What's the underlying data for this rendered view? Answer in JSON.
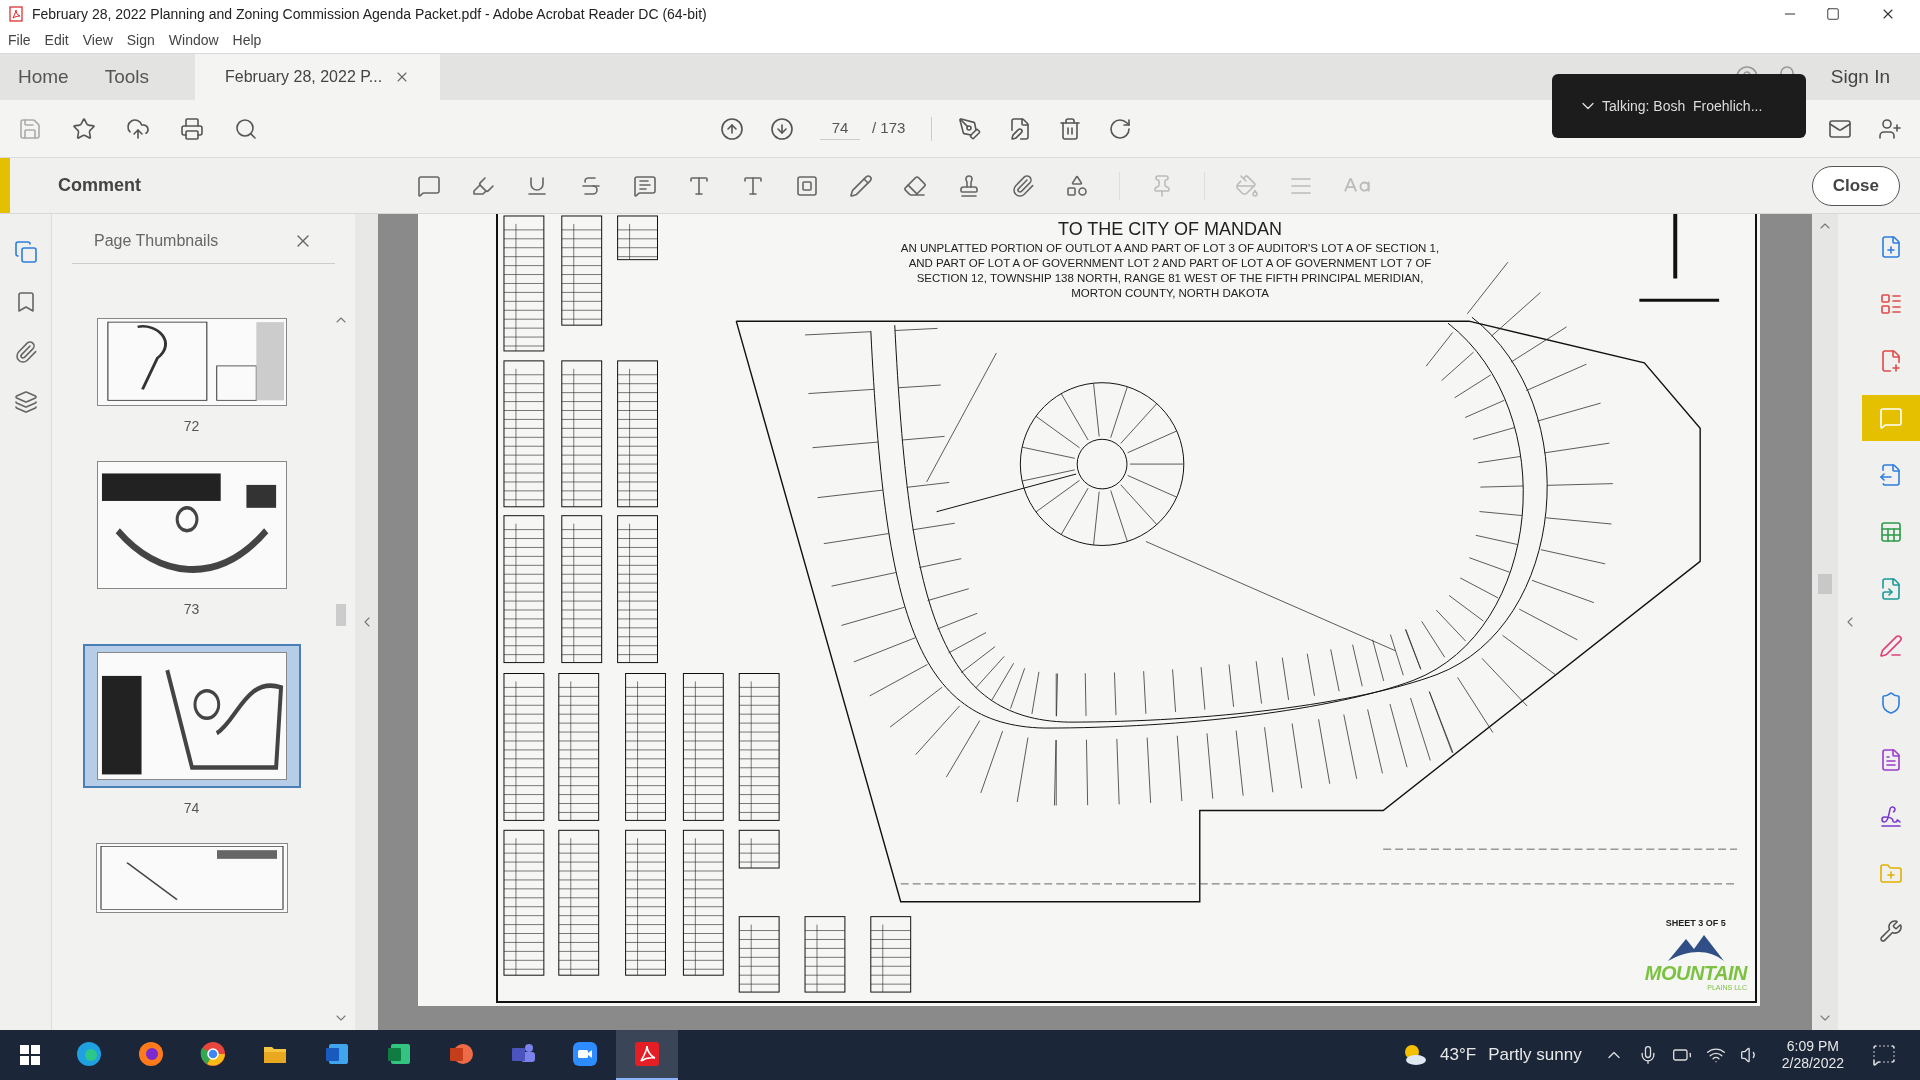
{
  "window": {
    "title": "February 28, 2022 Planning and Zoning Commission Agenda Packet.pdf - Adobe Acrobat Reader DC (64-bit)"
  },
  "menu": [
    "File",
    "Edit",
    "View",
    "Sign",
    "Window",
    "Help"
  ],
  "tabs": [
    {
      "label": "Home",
      "kind": "view",
      "selected": false
    },
    {
      "label": "Tools",
      "kind": "view",
      "selected": false
    },
    {
      "label": "February 28, 2022 P...",
      "kind": "document",
      "selected": true
    }
  ],
  "account": {
    "sign_in": "Sign In"
  },
  "toolbar": {
    "page": "74",
    "page_total": "/ 173"
  },
  "meeting_popup": {
    "text": "Talking: Bosh  Froehlich..."
  },
  "comment_bar": {
    "title": "Comment",
    "close": "Close"
  },
  "nav_rail": [
    {
      "selected": true
    },
    {
      "selected": false
    },
    {
      "selected": false
    },
    {
      "selected": false
    }
  ],
  "thumbnails": {
    "title": "Page Thumbnails",
    "pages": [
      {
        "label": "72",
        "selected": false
      },
      {
        "label": "73",
        "selected": false
      },
      {
        "label": "74",
        "selected": true
      }
    ]
  },
  "document": {
    "title": "TO THE CITY OF MANDAN",
    "description_lines": [
      "AN UNPLATTED PORTION OF OUTLOT A AND PART OF LOT 3 OF AUDITOR'S LOT A OF SECTION 1,",
      "AND PART OF LOT A OF GOVERNMENT LOT 2 AND PART OF LOT A OF GOVERNMENT LOT 7 OF",
      "SECTION 12, TOWNSHIP 138 NORTH, RANGE 81 WEST OF THE FIFTH PRINCIPAL MERIDIAN,",
      "MORTON COUNTY, NORTH DAKOTA"
    ],
    "sheet": "SHEET 3 OF 5",
    "logo_name": "MOUNTAIN",
    "logo_sub": "PLAINS LLC"
  },
  "tool_rail": [
    {
      "selected": false
    },
    {
      "selected": false
    },
    {
      "selected": false
    },
    {
      "selected": true
    },
    {
      "selected": false
    },
    {
      "selected": false
    },
    {
      "selected": false
    },
    {
      "selected": false
    },
    {
      "selected": false
    },
    {
      "selected": false
    },
    {
      "selected": false
    },
    {
      "selected": false
    },
    {
      "selected": false
    }
  ],
  "taskbar": {
    "apps": [
      {
        "selected": false
      },
      {
        "selected": false
      },
      {
        "selected": false
      },
      {
        "selected": false
      },
      {
        "selected": false
      },
      {
        "selected": false
      },
      {
        "selected": false
      },
      {
        "selected": false
      },
      {
        "selected": false
      },
      {
        "selected": true
      }
    ],
    "temperature": "43°F",
    "weather": "Partly sunny",
    "time": "6:09 PM",
    "date": "2/28/2022"
  }
}
